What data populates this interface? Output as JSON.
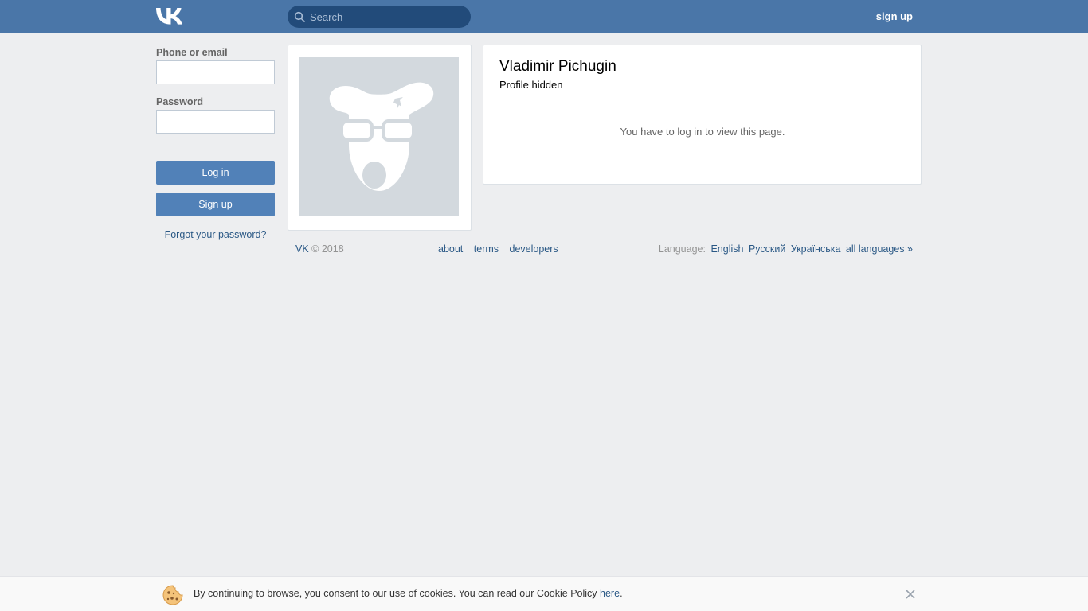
{
  "header": {
    "logo": "vk-logo",
    "search_placeholder": "Search",
    "signup_label": "sign up"
  },
  "login": {
    "phone_label": "Phone or email",
    "phone_value": "",
    "password_label": "Password",
    "password_value": "",
    "login_button": "Log in",
    "signup_button": "Sign up",
    "forgot_link": "Forgot your password?"
  },
  "profile": {
    "avatar": "deactivated-dog-avatar",
    "name": "Vladimir Pichugin",
    "status": "Profile hidden",
    "notice": "You have to log in to view this page."
  },
  "footer": {
    "brand": "VK",
    "copyright": "© 2018",
    "links": [
      "about",
      "terms",
      "developers"
    ],
    "language_label": "Language:",
    "languages": [
      "English",
      "Русский",
      "Українська",
      "all languages »"
    ]
  },
  "cookie_bar": {
    "text": "By continuing to browse, you consent to our use of cookies. You can read our Cookie Policy ",
    "link": "here",
    "suffix": "."
  },
  "colors": {
    "header_bg": "#4a76a8",
    "button_bg": "#5181b8",
    "link": "#2a5885",
    "page_bg": "#edeef0"
  }
}
